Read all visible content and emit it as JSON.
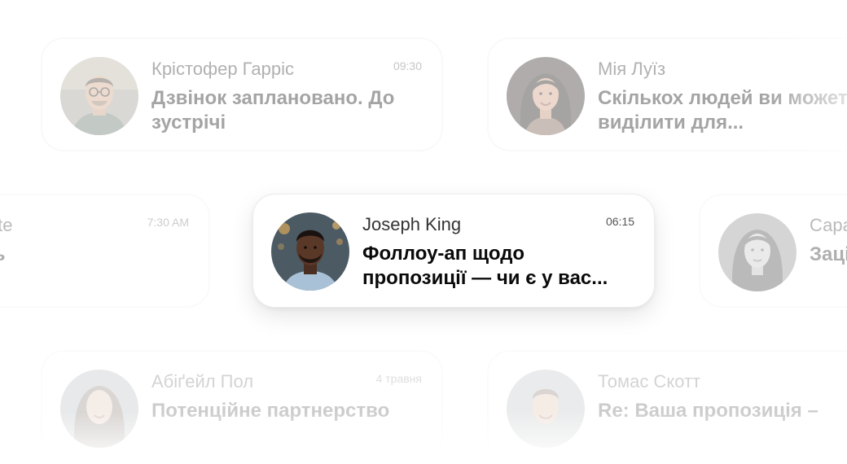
{
  "notifications": [
    {
      "name": "Крістофер Гарріс",
      "time": "09:30",
      "message": "Дзвінок заплановано. До зустрічі",
      "avatar": "portrait-man-glasses"
    },
    {
      "name": "Мія Луїз",
      "time": "",
      "message": "Скількох людей ви можете виділити для...",
      "avatar": "portrait-woman-dark-hair"
    },
    {
      "name": "nite",
      "time": "7:30 AM",
      "message": "ть",
      "avatar": ""
    },
    {
      "name": "Joseph King",
      "time": "06:15",
      "message": "Фоллоу-ап щодо пропозиції — чи є у вас...",
      "avatar": "portrait-man-beard"
    },
    {
      "name": "Сара",
      "time": "",
      "message": "Заці",
      "avatar": "portrait-woman-black-and-white"
    },
    {
      "name": "Абіґейл Пол",
      "time": "4 травня",
      "message": "Потенційне партнерство",
      "avatar": "portrait-woman-smiling"
    },
    {
      "name": "Томас Скотт",
      "time": "",
      "message": "Re: Ваша пропозиція –",
      "avatar": "portrait-man-smiling"
    }
  ],
  "colors": {
    "background": "#ffffff",
    "card_border": "#f1f1f3",
    "name_text": "#3d3d3d",
    "message_text": "#1e1e1e",
    "time_text": "#6f6f6f"
  }
}
